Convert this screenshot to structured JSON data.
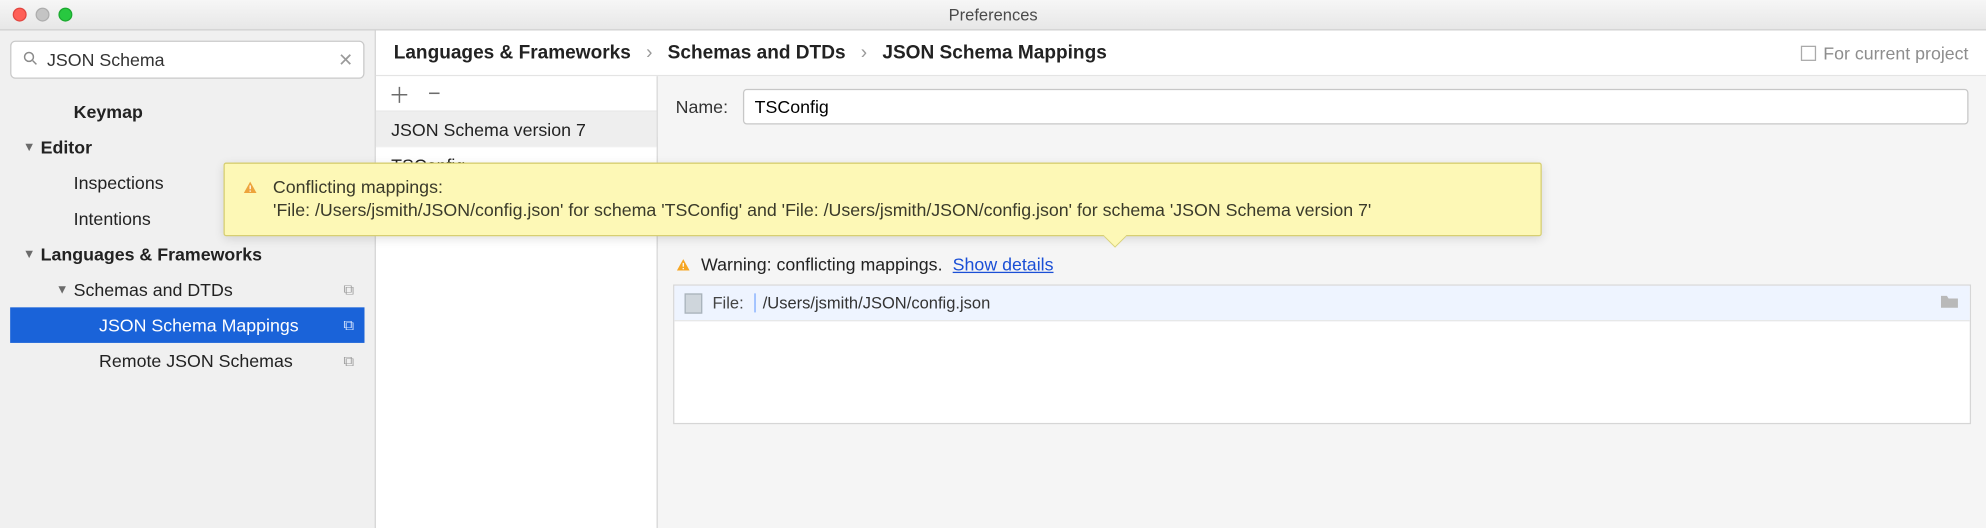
{
  "window": {
    "title": "Preferences"
  },
  "search": {
    "value": "JSON Schema",
    "placeholder": ""
  },
  "sidebar": {
    "items": [
      {
        "label": "Keymap",
        "level": "l2",
        "bold": true,
        "arrow": ""
      },
      {
        "label": "Editor",
        "level": "l1",
        "bold": true,
        "arrow": "▼"
      },
      {
        "label": "Inspections",
        "level": "l2",
        "bold": false,
        "arrow": "",
        "badge": "⧉"
      },
      {
        "label": "Intentions",
        "level": "l2",
        "bold": false,
        "arrow": ""
      },
      {
        "label": "Languages & Frameworks",
        "level": "l1",
        "bold": true,
        "arrow": "▼"
      },
      {
        "label": "Schemas and DTDs",
        "level": "l2",
        "bold": false,
        "arrow": "▼",
        "badge": "⧉"
      },
      {
        "label": "JSON Schema Mappings",
        "level": "l3",
        "bold": false,
        "arrow": "",
        "selected": true,
        "badge": "⧉"
      },
      {
        "label": "Remote JSON Schemas",
        "level": "l3",
        "bold": false,
        "arrow": "",
        "badge": "⧉"
      }
    ]
  },
  "breadcrumbs": {
    "a": "Languages & Frameworks",
    "b": "Schemas and DTDs",
    "c": "JSON Schema Mappings",
    "scope": "For current project"
  },
  "schemaList": {
    "items": [
      {
        "label": "JSON Schema version 7",
        "selected": true
      },
      {
        "label": "TSConfig",
        "selected": false
      }
    ]
  },
  "form": {
    "name_label": "Name:",
    "name_value": "TSConfig"
  },
  "warning": {
    "text": "Warning: conflicting mappings. ",
    "link": "Show details"
  },
  "file": {
    "label": "File:",
    "path": "/Users/jsmith/JSON/config.json"
  },
  "tooltip": {
    "title": "Conflicting mappings:",
    "body": "'File: /Users/jsmith/JSON/config.json' for schema 'TSConfig' and 'File: /Users/jsmith/JSON/config.json' for schema 'JSON Schema version 7'"
  }
}
